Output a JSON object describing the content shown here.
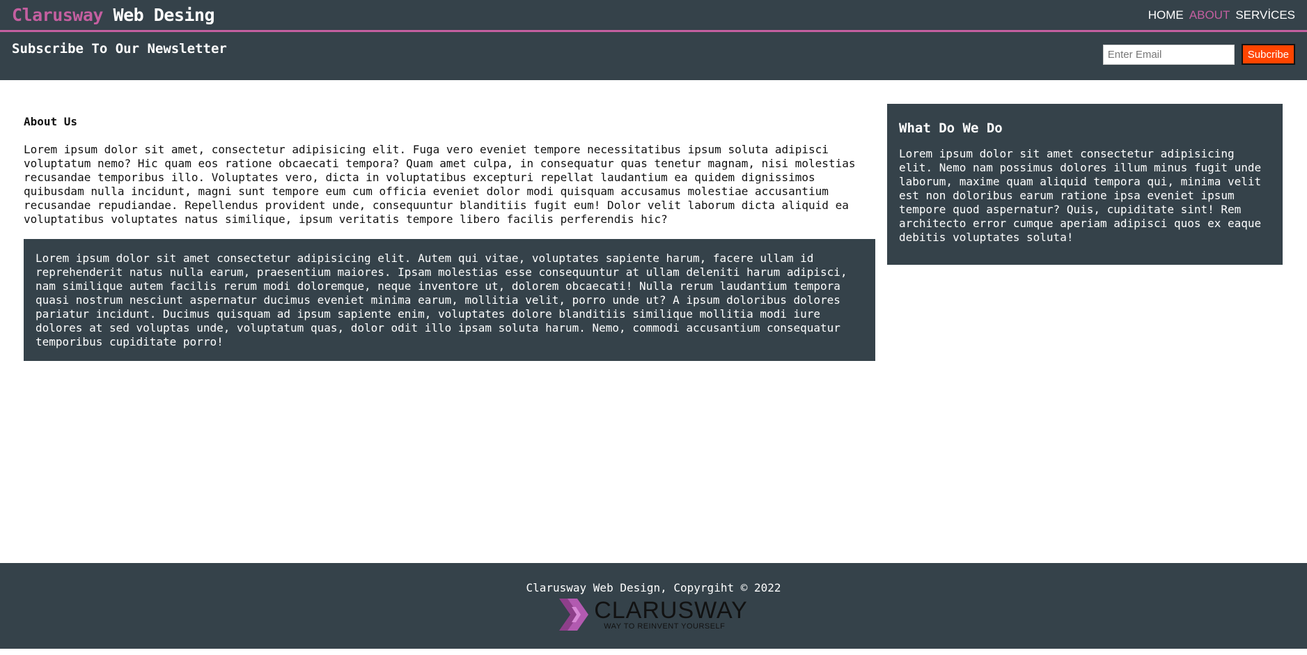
{
  "brand": {
    "highlight": "Clarusway",
    "rest": " Web Desing"
  },
  "nav": [
    {
      "label": "HOME"
    },
    {
      "label": "ABOUT"
    },
    {
      "label": "SERVİCES"
    }
  ],
  "newsletter": {
    "title": "Subscribe To Our Newsletter",
    "email_placeholder": "Enter Email",
    "button_label": "Subcribe"
  },
  "about": {
    "heading": "About Us",
    "text": "Lorem ipsum dolor sit amet, consectetur adipisicing elit. Fuga vero eveniet tempore necessitatibus ipsum soluta adipisci voluptatum nemo? Hic quam eos ratione obcaecati tempora? Quam amet culpa, in consequatur quas tenetur magnam, nisi molestias recusandae temporibus illo. Voluptates vero, dicta in voluptatibus excepturi repellat laudantium ea quidem dignissimos quibusdam nulla incidunt, magni sunt tempore eum cum officia eveniet dolor modi quisquam accusamus molestiae accusantium recusandae repudiandae. Repellendus provident unde, consequuntur blanditiis fugit eum! Dolor velit laborum dicta aliquid ea voluptatibus voluptates natus similique, ipsum veritatis tempore libero facilis perferendis hic?",
    "box_text": "Lorem ipsum dolor sit amet consectetur adipisicing elit. Autem qui vitae, voluptates sapiente harum, facere ullam id reprehenderit natus nulla earum, praesentium maiores. Ipsam molestias esse consequuntur at ullam deleniti harum adipisci, nam similique autem facilis rerum modi doloremque, neque inventore ut, dolorem obcaecati! Nulla rerum laudantium tempora quasi nostrum nesciunt aspernatur ducimus eveniet minima earum, mollitia velit, porro unde ut? A ipsum doloribus dolores pariatur incidunt. Ducimus quisquam ad ipsum sapiente enim, voluptates dolore blanditiis similique mollitia modi iure dolores at sed voluptas unde, voluptatum quas, dolor odit illo ipsam soluta harum. Nemo, commodi accusantium consequatur temporibus cupiditate porro!"
  },
  "sidebar": {
    "heading": "What Do We Do",
    "text": "Lorem ipsum dolor sit amet consectetur adipisicing elit. Nemo nam possimus dolores illum minus fugit unde laborum, maxime quam aliquid tempora qui, minima velit est non doloribus earum ratione ipsa eveniet ipsum tempore quod aspernatur? Quis, cupiditate sint! Rem architecto error cumque aperiam adipisci quos ex eaque debitis voluptates soluta!"
  },
  "footer": {
    "copyright": "Clarusway Web Design, Copyrgiht © 2022",
    "logo_name": "CLARUSWAY",
    "logo_tagline": "WAY TO REINVENT YOURSELF"
  },
  "colors": {
    "dark": "#35424a",
    "accent": "#c45fa0",
    "subscribe_button": "#ff4500"
  }
}
